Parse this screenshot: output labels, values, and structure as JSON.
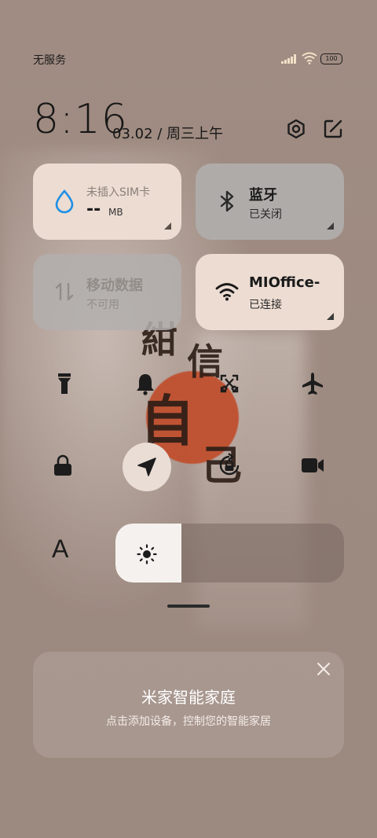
{
  "status_bar": {
    "carrier": "无服务",
    "battery": "100"
  },
  "header": {
    "time": "8:16",
    "date": "03.02 / 周三上午"
  },
  "tiles": {
    "sim": {
      "title": "未插入SIM卡",
      "value": "--",
      "unit": "MB"
    },
    "bluetooth": {
      "title": "蓝牙",
      "status": "已关闭"
    },
    "mobile_data": {
      "title": "移动数据",
      "status": "不可用"
    },
    "wifi": {
      "title": "MIOffice-",
      "status": "已连接"
    }
  },
  "brightness": {
    "level": 0.29
  },
  "font_size_label": "A",
  "mi_home": {
    "title": "米家智能家庭",
    "subtitle": "点击添加设备，控制您的智能家居"
  }
}
